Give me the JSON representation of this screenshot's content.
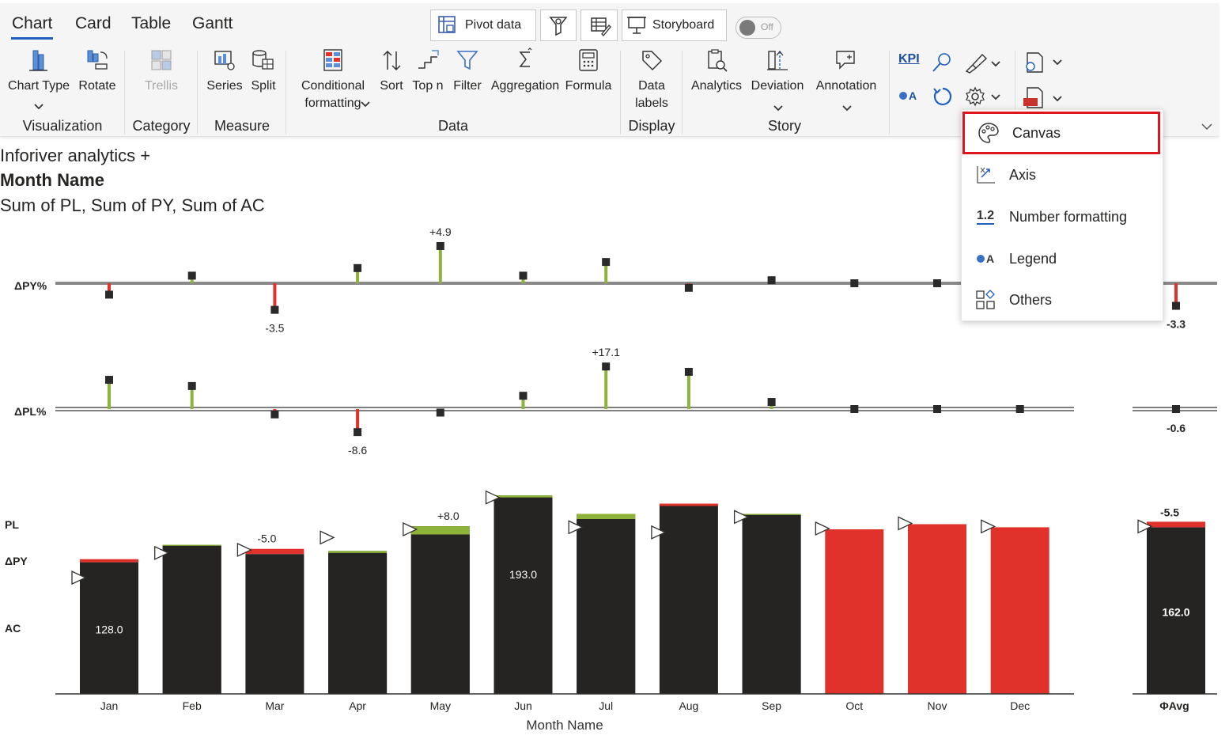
{
  "tabs": [
    {
      "label": "Chart",
      "active": true
    },
    {
      "label": "Card"
    },
    {
      "label": "Table"
    },
    {
      "label": "Gantt"
    }
  ],
  "top_buttons": {
    "pivot_label": "Pivot data",
    "storyboard_label": "Storyboard",
    "toggle_label": "Off"
  },
  "ribbon": {
    "chart_type": "Chart Type",
    "rotate": "Rotate",
    "trellis": "Trellis",
    "series": "Series",
    "split": "Split",
    "conditional_1": "Conditional",
    "conditional_2": "formatting",
    "sort": "Sort",
    "top_n": "Top n",
    "filter": "Filter",
    "aggregation": "Aggregation",
    "formula": "Formula",
    "data_labels_1": "Data",
    "data_labels_2": "labels",
    "analytics": "Analytics",
    "deviation": "Deviation",
    "annotation": "Annotation",
    "kpi": "KPI",
    "oa": "A"
  },
  "groups": {
    "visualization": "Visualization",
    "category": "Category",
    "measure": "Measure",
    "data": "Data",
    "display": "Display",
    "story": "Story"
  },
  "header": {
    "line1": "Inforiver analytics +",
    "line2": "Month Name",
    "line3": "Sum of PL, Sum of PY, Sum of AC"
  },
  "menu": {
    "items": [
      {
        "label": "Canvas",
        "icon": "palette-icon",
        "highlighted": true
      },
      {
        "label": "Axis",
        "icon": "axis-icon"
      },
      {
        "label": "Number formatting",
        "icon": "number-format-icon",
        "icon_text": "1.2"
      },
      {
        "label": "Legend",
        "icon": "legend-icon",
        "icon_text": "A"
      },
      {
        "label": "Others",
        "icon": "others-icon"
      }
    ]
  },
  "colors": {
    "accent": "#1f5fbf",
    "ac": "#252423",
    "positive": "#8db33a",
    "negative": "#e0322b",
    "highlight_border": "#e0141d"
  },
  "chart_data": {
    "type": "bar",
    "xlabel": "Month Name",
    "categories": [
      "Jan",
      "Feb",
      "Mar",
      "Apr",
      "May",
      "Jun",
      "Jul",
      "Aug",
      "Sep",
      "Oct",
      "Nov",
      "Dec"
    ],
    "row_labels": {
      "dpy_pct": "ΔPY%",
      "dpl_pct": "ΔPL%",
      "pl": "PL",
      "dpy": "ΔPY",
      "ac": "AC"
    },
    "ac": [
      128,
      145,
      136,
      139,
      163,
      193,
      175,
      184,
      175,
      null,
      null,
      null
    ],
    "py": [
      131,
      144,
      141,
      137,
      155,
      191,
      170,
      185,
      174,
      160,
      165,
      162
    ],
    "pl": [
      113,
      137,
      140,
      152,
      160,
      191,
      162,
      157,
      172,
      null,
      null,
      null
    ],
    "dpy_pct": [
      -1.5,
      1.0,
      -3.5,
      2.0,
      4.9,
      1.0,
      2.8,
      -0.6,
      0.4,
      0,
      0,
      null
    ],
    "dpl_pct": [
      3.3,
      2.6,
      -0.6,
      -2.6,
      -0.4,
      1.5,
      4.8,
      4.2,
      0.8,
      0,
      0,
      0
    ],
    "data_labels": {
      "dpy_pct": {
        "4": "+4.9",
        "2": "-3.5"
      },
      "dpl_pct": {
        "6": "+17.1",
        "3": "-8.6"
      },
      "dpy": {
        "2": "-5.0",
        "4": "+8.0"
      },
      "ac": {
        "0": "128.0",
        "5": "193.0"
      }
    },
    "avg": {
      "label": "ΦAvg",
      "ac": 162.0,
      "ac_label": "162.0",
      "dpy": -5.5,
      "dpy_label": "-5.5",
      "dpy_pct": -3.3,
      "dpy_pct_label": "-3.3",
      "dpl_pct": -0.6,
      "dpl_pct_label": "-0.6"
    },
    "ylim": [
      0,
      220
    ]
  }
}
